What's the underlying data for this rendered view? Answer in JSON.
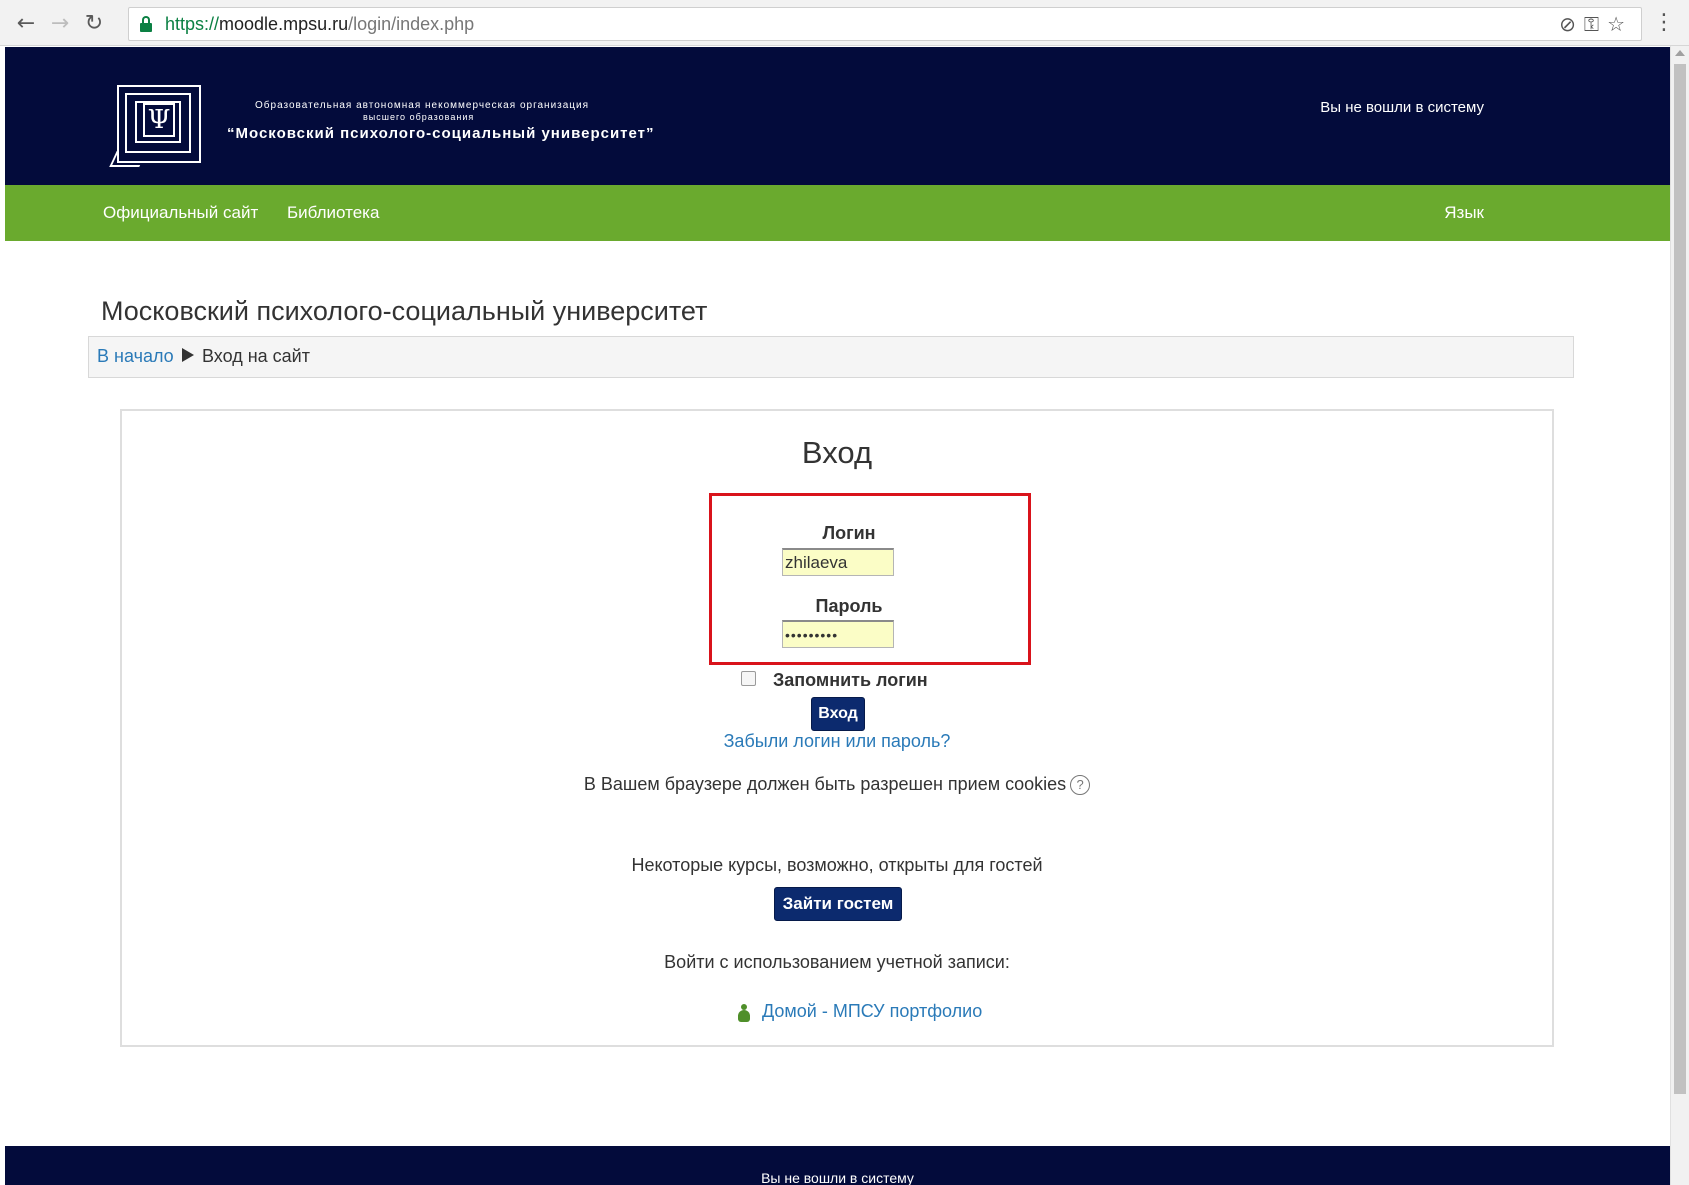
{
  "browser": {
    "url_scheme": "https://",
    "url_host": "moodle.mpsu.ru",
    "url_path": "/login/index.php",
    "back_icon": "arrow-left-icon",
    "forward_icon": "arrow-right-icon",
    "reload_icon": "reload-icon",
    "lock_icon": "lock-icon"
  },
  "header": {
    "org_line1": "Образовательная автономная некоммерческая организация",
    "org_line2": "высшего образования",
    "org_name": "“Московский психолого-социальный университет”",
    "login_status": "Вы не вошли в систему",
    "background": "#030b3b"
  },
  "nav": {
    "official_site": "Официальный сайт",
    "library": "Библиотека",
    "language": "Язык",
    "background": "#6aaa2e"
  },
  "page": {
    "heading": "Московский психолого-социальный университет"
  },
  "breadcrumb": {
    "home": "В начало",
    "current": "Вход на сайт"
  },
  "login": {
    "title": "Вход",
    "username_label": "Логин",
    "username_value": "zhilaeva",
    "password_label": "Пароль",
    "password_value": "•••••••••",
    "remember_label": "Запомнить логин",
    "submit_label": "Вход",
    "forgot_link": "Забыли логин или пароль?",
    "cookies_notice": "В Вашем браузере должен быть разрешен прием cookies",
    "help_glyph": "?",
    "guest_notice": "Некоторые курсы, возможно, открыты для гостей",
    "guest_button": "Зайти гостем",
    "oauth_notice": "Войти с использованием учетной записи:",
    "idp_link": "Домой - МПСУ портфолио",
    "highlight_color": "#d9131b",
    "button_color": "#0c2a6e",
    "link_color": "#2a7ab8"
  },
  "footer": {
    "login_status": "Вы не вошли в систему"
  }
}
